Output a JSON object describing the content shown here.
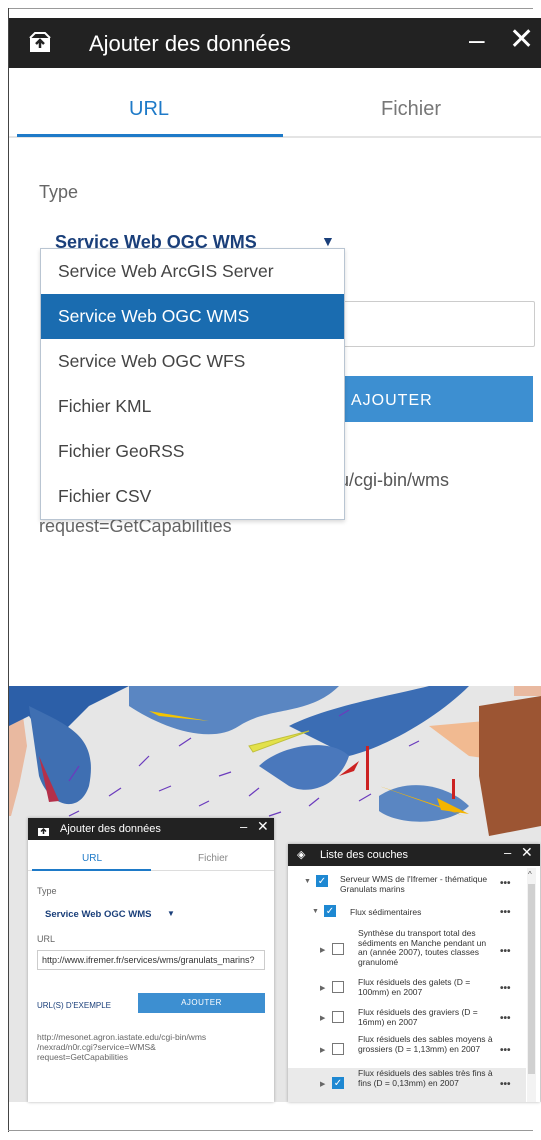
{
  "zoom": {
    "header": {
      "title": "Ajouter des données",
      "minimize": "–",
      "close": "✕"
    },
    "tabs": {
      "url": "URL",
      "file": "Fichier"
    },
    "type_label": "Type",
    "type_selected": "Service Web OGC WMS",
    "add_button": "AJOUTER",
    "url_fragment": "du/cgi-bin/wms",
    "url_fragment2": "request=GetCapabilities",
    "dropdown": {
      "options": [
        "Service Web ArcGIS Server",
        "Service Web OGC WMS",
        "Service Web OGC WFS",
        "Fichier KML",
        "Fichier GeoRSS",
        "Fichier CSV"
      ],
      "selected_index": 1
    }
  },
  "small_panel": {
    "header": {
      "title": "Ajouter des données",
      "minimize": "–",
      "close": "✕"
    },
    "tabs": {
      "url": "URL",
      "file": "Fichier"
    },
    "type_label": "Type",
    "type_selected": "Service Web OGC WMS",
    "url_label": "URL",
    "url_value": "http://www.ifremer.fr/services/wms/granulats_marins?",
    "example_link": "URL(S) D'EXEMPLE",
    "add_button": "AJOUTER",
    "service_url_line1": "http://mesonet.agron.iastate.edu/cgi-bin/wms",
    "service_url_line2": "/nexrad/n0r.cgi?service=WMS&",
    "service_url_line3": "request=GetCapabilities"
  },
  "layer_list": {
    "header": {
      "title": "Liste des couches",
      "minimize": "–",
      "close": "✕"
    },
    "more": "•••",
    "layers": [
      {
        "label": "Serveur WMS de l'Ifremer - thématique Granulats marins",
        "checked": true
      },
      {
        "label": "Flux sédimentaires",
        "checked": true
      },
      {
        "label": "Synthèse du transport total des sédiments en Manche pendant un an (année 2007), toutes classes granulomé",
        "checked": false
      },
      {
        "label": "Flux résiduels des galets (D = 100mm) en 2007",
        "checked": false
      },
      {
        "label": "Flux résiduels des graviers (D = 16mm) en 2007",
        "checked": false
      },
      {
        "label": "Flux résiduels des sables moyens à grossiers (D = 1,13mm) en 2007",
        "checked": false
      },
      {
        "label": "Flux résiduels des sables très fins à fins (D = 0,13mm) en 2007",
        "checked": true
      }
    ]
  },
  "colors": {
    "header_bg": "#222222",
    "accent": "#1e7ac8",
    "button": "#3d8fd1",
    "selected_option": "#1a6cb0"
  }
}
